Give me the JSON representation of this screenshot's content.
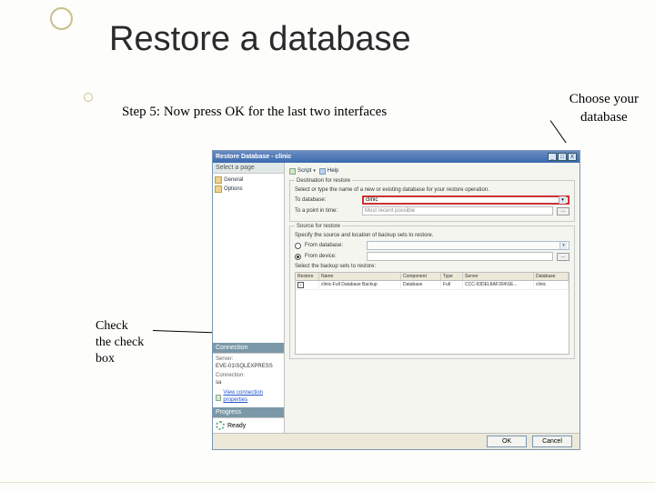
{
  "slide": {
    "title": "Restore a database",
    "subtitle": "Step 5: Now press OK for the last two interfaces",
    "callout_right": "Choose your\ndatabase",
    "callout_left": "Check\nthe check\n box"
  },
  "dialog": {
    "title": "Restore Database - clinic",
    "win": {
      "min": "_",
      "max": "□",
      "close": "X"
    },
    "left": {
      "select_page": "Select a page",
      "items": [
        {
          "label": "General"
        },
        {
          "label": "Options"
        }
      ],
      "connection_head": "Connection",
      "server_label": "Server:",
      "server_value": "EVE-01\\SQLEXPRESS",
      "connection_label": "Connection:",
      "connection_value": "sa",
      "view_conn": "View connection properties",
      "progress_head": "Progress",
      "progress_value": "Ready"
    },
    "toolbar": {
      "script": "Script",
      "help": "Help"
    },
    "dest": {
      "group": "Destination for restore",
      "hint": "Select or type the name of a new or existing database for your restore operation.",
      "to_db_label": "To database:",
      "to_db_value": "clinic",
      "to_point_label": "To a point in time:",
      "to_point_value": "Most recent possible",
      "dots": "..."
    },
    "source": {
      "group": "Source for restore",
      "hint": "Specify the source and location of backup sets to restore.",
      "from_db": "From database:",
      "from_device": "From device:",
      "dots": "...",
      "select_hint": "Select the backup sets to restore:",
      "cols": {
        "restore": "Restore",
        "name": "Name",
        "component": "Component",
        "type": "Type",
        "server": "Server",
        "database": "Database"
      },
      "row": {
        "checked": "✓",
        "name": "clinic-Full Database Backup",
        "component": "Database",
        "type": "Full",
        "server": "CCC-93DEL8AF304\\SE...",
        "database": "clinic"
      }
    },
    "footer": {
      "ok": "OK",
      "cancel": "Cancel"
    }
  }
}
